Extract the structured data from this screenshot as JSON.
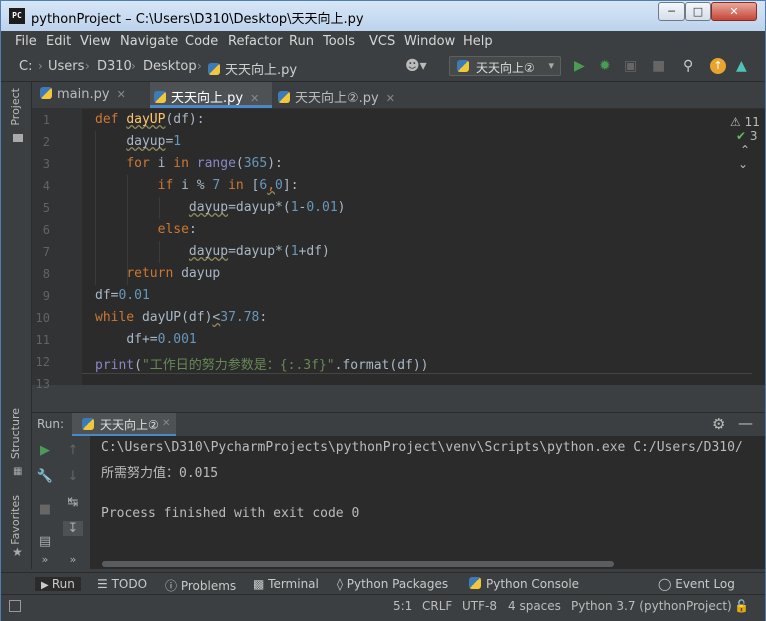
{
  "window": {
    "title": "pythonProject – C:\\Users\\D310\\Desktop\\天天向上.py",
    "app_icon": "PC"
  },
  "menu": [
    "File",
    "Edit",
    "View",
    "Navigate",
    "Code",
    "Refactor",
    "Run",
    "Tools",
    "VCS",
    "Window",
    "Help"
  ],
  "breadcrumb": [
    "C:",
    "Users",
    "D310",
    "Desktop",
    "天天向上.py"
  ],
  "run_config": "天天向上②",
  "sidebar_left": {
    "project": "Project",
    "structure": "Structure",
    "favorites": "Favorites"
  },
  "tabs": [
    {
      "label": "main.py"
    },
    {
      "label": "天天向上.py"
    },
    {
      "label": "天天向上②.py"
    }
  ],
  "inspections": {
    "warnings": "11",
    "ok": "3"
  },
  "line_numbers": [
    "1",
    "2",
    "3",
    "4",
    "5",
    "6",
    "7",
    "8",
    "9",
    "10",
    "11",
    "12",
    "13"
  ],
  "code": {
    "l1": {
      "kw": "def",
      "fn": "dayUP",
      "rest": "(df):"
    },
    "l2": {
      "var": "dayup",
      "op": "=",
      "num": "1"
    },
    "l3": {
      "kw": "for",
      "mid": " i ",
      "kw2": "in",
      "sp": " ",
      "bi": "range",
      "open": "(",
      "num": "365",
      "close": "):"
    },
    "l4": {
      "kw": "if",
      "a": " i % ",
      "num": "7",
      "sp": " ",
      "kw2": "in",
      "b": " [",
      "n1": "6",
      "comma": ",",
      "n2": "0",
      "c": "]:"
    },
    "l5": {
      "var": "dayup",
      "a": "=dayup*(",
      "n1": "1",
      "b": "-",
      "n2": "0.01",
      "c": ")"
    },
    "l6": {
      "kw": "else",
      "rest": ":"
    },
    "l7": {
      "var": "dayup",
      "a": "=dayup*(",
      "n1": "1",
      "b": "+df)"
    },
    "l8": {
      "kw": "return",
      "rest": " dayup"
    },
    "l9": {
      "a": "df=",
      "num": "0.01"
    },
    "l10": {
      "kw": "while",
      "a": " dayUP(df)",
      "lt": "<",
      "num": "37.78",
      "c": ":"
    },
    "l11": {
      "a": "df+=",
      "num": "0.001"
    },
    "l12": {
      "bi": "print",
      "a": "(",
      "str": "\"工作日的努力参数是：{:.3f}\"",
      "b": ".format(df))"
    }
  },
  "run_panel": {
    "label": "Run:",
    "tab": "天天向上②",
    "console": [
      "C:\\Users\\D310\\PycharmProjects\\pythonProject\\venv\\Scripts\\python.exe C:/Users/D310/",
      "所需努力值：0.015",
      "",
      "Process finished with exit code 0"
    ]
  },
  "bottom_tools": [
    "Run",
    "TODO",
    "Problems",
    "Terminal",
    "Python Packages",
    "Python Console",
    "Event Log"
  ],
  "status": {
    "position": "5:1",
    "line_sep": "CRLF",
    "encoding": "UTF-8",
    "indent": "4 spaces",
    "interpreter": "Python 3.7 (pythonProject)"
  }
}
